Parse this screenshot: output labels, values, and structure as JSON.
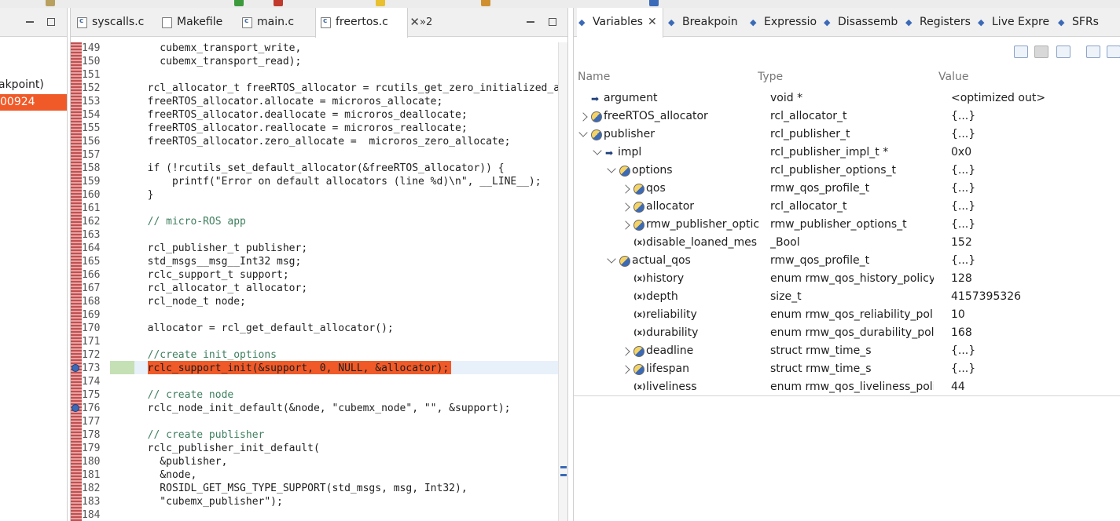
{
  "left_pane": {
    "partial_text": "akpoint)",
    "highlight_text": "00924"
  },
  "editor": {
    "tabs": [
      {
        "label": "syscalls.c",
        "icon": "c-file-icon"
      },
      {
        "label": "Makefile",
        "icon": "makefile-icon"
      },
      {
        "label": "main.c",
        "icon": "c-file-icon"
      },
      {
        "label": "freertos.c",
        "icon": "c-file-icon",
        "active": true
      }
    ],
    "tab_overflow": "»2",
    "lines": [
      {
        "n": "149",
        "t": "    cubemx_transport_write,"
      },
      {
        "n": "150",
        "t": "    cubemx_transport_read);"
      },
      {
        "n": "151",
        "t": ""
      },
      {
        "n": "152",
        "t": "  rcl_allocator_t freeRTOS_allocator = rcutils_get_zero_initialized_al"
      },
      {
        "n": "153",
        "t": "  freeRTOS_allocator.allocate = microros_allocate;"
      },
      {
        "n": "154",
        "t": "  freeRTOS_allocator.deallocate = microros_deallocate;"
      },
      {
        "n": "155",
        "t": "  freeRTOS_allocator.reallocate = microros_reallocate;"
      },
      {
        "n": "156",
        "t": "  freeRTOS_allocator.zero_allocate =  microros_zero_allocate;"
      },
      {
        "n": "157",
        "t": ""
      },
      {
        "n": "158",
        "t": "  if (!rcutils_set_default_allocator(&freeRTOS_allocator)) {"
      },
      {
        "n": "159",
        "t": "      printf(\"Error on default allocators (line %d)\\n\", __LINE__);"
      },
      {
        "n": "160",
        "t": "  }"
      },
      {
        "n": "161",
        "t": ""
      },
      {
        "n": "162",
        "t": "  // micro-ROS app"
      },
      {
        "n": "163",
        "t": ""
      },
      {
        "n": "164",
        "t": "  rcl_publisher_t publisher;"
      },
      {
        "n": "165",
        "t": "  std_msgs__msg__Int32 msg;"
      },
      {
        "n": "166",
        "t": "  rclc_support_t support;"
      },
      {
        "n": "167",
        "t": "  rcl_allocator_t allocator;"
      },
      {
        "n": "168",
        "t": "  rcl_node_t node;"
      },
      {
        "n": "169",
        "t": ""
      },
      {
        "n": "170",
        "t": "  allocator = rcl_get_default_allocator();"
      },
      {
        "n": "171",
        "t": ""
      },
      {
        "n": "172",
        "t": "  //create init_options"
      },
      {
        "n": "173",
        "t": "  rclc_support_init(&support, 0, NULL, &allocator);"
      },
      {
        "n": "174",
        "t": ""
      },
      {
        "n": "175",
        "t": "  // create node"
      },
      {
        "n": "176",
        "t": "  rclc_node_init_default(&node, \"cubemx_node\", \"\", &support);"
      },
      {
        "n": "177",
        "t": ""
      },
      {
        "n": "178",
        "t": "  // create publisher"
      },
      {
        "n": "179",
        "t": "  rclc_publisher_init_default("
      },
      {
        "n": "180",
        "t": "    &publisher,"
      },
      {
        "n": "181",
        "t": "    &node,"
      },
      {
        "n": "182",
        "t": "    ROSIDL_GET_MSG_TYPE_SUPPORT(std_msgs, msg, Int32),"
      },
      {
        "n": "183",
        "t": "    \"cubemx_publisher\");"
      },
      {
        "n": "184",
        "t": ""
      }
    ],
    "current_line_text": "rclc_support_init(&support, 0, NULL, &allocator);"
  },
  "variables_view": {
    "tabs": [
      {
        "label": "Variables",
        "icon": "variables-icon",
        "active": true
      },
      {
        "label": "Breakpoin",
        "icon": "breakpoints-icon"
      },
      {
        "label": "Expressio",
        "icon": "expressions-icon"
      },
      {
        "label": "Disassemb",
        "icon": "disassembly-icon"
      },
      {
        "label": "Registers",
        "icon": "registers-icon"
      },
      {
        "label": "Live Expre",
        "icon": "live-expressions-icon"
      },
      {
        "label": "SFRs",
        "icon": "sfrs-icon"
      }
    ],
    "columns": {
      "name": "Name",
      "type": "Type",
      "value": "Value"
    },
    "rows": [
      {
        "name": "argument",
        "type": "void *",
        "value": "<optimized out>",
        "indent": 0,
        "twisty": "none",
        "icon": "pointer"
      },
      {
        "name": "freeRTOS_allocator",
        "type": "rcl_allocator_t",
        "value": "{...}",
        "indent": 0,
        "twisty": "collapsed",
        "icon": "struct"
      },
      {
        "name": "publisher",
        "type": "rcl_publisher_t",
        "value": "{...}",
        "indent": 0,
        "twisty": "expanded",
        "icon": "struct"
      },
      {
        "name": "impl",
        "type": "rcl_publisher_impl_t *",
        "value": "0x0",
        "indent": 1,
        "twisty": "expanded",
        "icon": "pointer"
      },
      {
        "name": "options",
        "type": "rcl_publisher_options_t",
        "value": "{...}",
        "indent": 2,
        "twisty": "expanded",
        "icon": "struct"
      },
      {
        "name": "qos",
        "type": "rmw_qos_profile_t",
        "value": "{...}",
        "indent": 3,
        "twisty": "collapsed",
        "icon": "struct"
      },
      {
        "name": "allocator",
        "type": "rcl_allocator_t",
        "value": "{...}",
        "indent": 3,
        "twisty": "collapsed",
        "icon": "struct"
      },
      {
        "name": "rmw_publisher_optic",
        "type": "rmw_publisher_options_t",
        "value": "{...}",
        "indent": 3,
        "twisty": "collapsed",
        "icon": "struct"
      },
      {
        "name": "disable_loaned_mes",
        "type": "_Bool",
        "value": "152",
        "indent": 3,
        "twisty": "none",
        "icon": "var"
      },
      {
        "name": "actual_qos",
        "type": "rmw_qos_profile_t",
        "value": "{...}",
        "indent": 2,
        "twisty": "expanded",
        "icon": "struct"
      },
      {
        "name": "history",
        "type": "enum rmw_qos_history_policy_",
        "value": "128",
        "indent": 3,
        "twisty": "none",
        "icon": "var"
      },
      {
        "name": "depth",
        "type": "size_t",
        "value": "4157395326",
        "indent": 3,
        "twisty": "none",
        "icon": "var"
      },
      {
        "name": "reliability",
        "type": "enum rmw_qos_reliability_polic",
        "value": "10",
        "indent": 3,
        "twisty": "none",
        "icon": "var"
      },
      {
        "name": "durability",
        "type": "enum rmw_qos_durability_poli",
        "value": "168",
        "indent": 3,
        "twisty": "none",
        "icon": "var"
      },
      {
        "name": "deadline",
        "type": "struct rmw_time_s",
        "value": "{...}",
        "indent": 3,
        "twisty": "collapsed",
        "icon": "struct"
      },
      {
        "name": "lifespan",
        "type": "struct rmw_time_s",
        "value": "{...}",
        "indent": 3,
        "twisty": "collapsed",
        "icon": "struct"
      },
      {
        "name": "liveliness",
        "type": "enum rmw_qos_liveliness_polic",
        "value": "44",
        "indent": 3,
        "twisty": "none",
        "icon": "var"
      }
    ]
  }
}
